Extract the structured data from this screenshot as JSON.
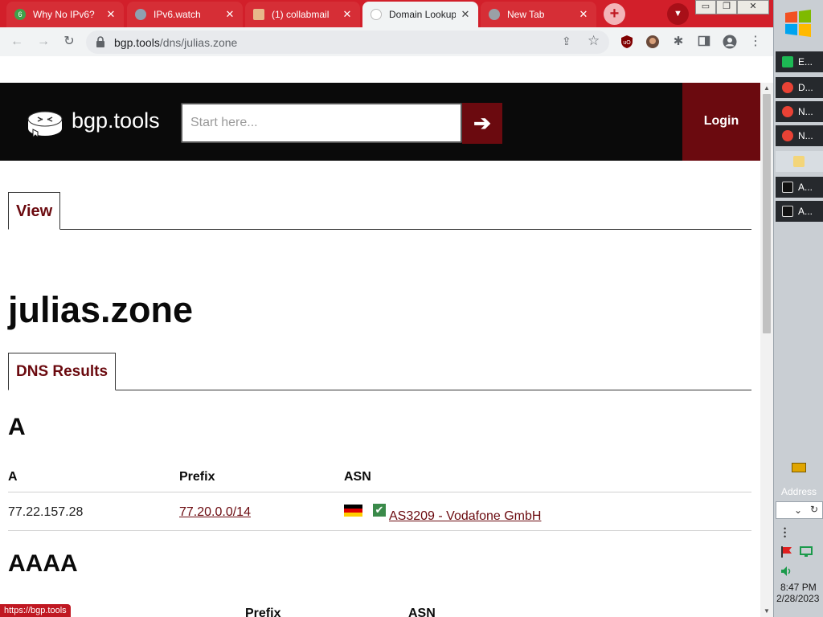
{
  "browser": {
    "tabs": [
      {
        "title": "Why No IPv6?",
        "state": "inactive"
      },
      {
        "title": "IPv6.watch",
        "state": "inactive"
      },
      {
        "title": "(1) collabmail",
        "state": "inactive"
      },
      {
        "title": "Domain Lookup",
        "state": "active"
      },
      {
        "title": "New Tab",
        "state": "inactive"
      }
    ],
    "new_tab_glyph": "+",
    "tab_close_glyph": "✕",
    "window_controls": {
      "minimize": "▭",
      "restore": "❐",
      "close": "✕"
    },
    "url_host": "bgp.tools",
    "url_path": "/dns/julias.zone",
    "omnibox_icons": {
      "share": "⇪",
      "star": "☆"
    },
    "extensions": [
      "ublock-origin-icon",
      "profile-photo-icon",
      "puzzle-extensions-icon",
      "side-panel-icon",
      "account-icon",
      "menu-dots-icon"
    ],
    "accent_color": "#d21f2a"
  },
  "site": {
    "name": "bgp.tools",
    "search_placeholder": "Start here...",
    "search_arrow": "➔",
    "login_label": "Login",
    "brand_color": "#6b0a0f"
  },
  "content": {
    "view_tab_label": "View",
    "domain": "julias.zone",
    "results_tab_label": "DNS Results",
    "a_section": {
      "heading": "A",
      "columns": [
        "A",
        "Prefix",
        "ASN"
      ],
      "rows": [
        {
          "address": "77.22.157.28",
          "prefix": "77.20.0.0/14",
          "asn_flag": "germany-flag-icon",
          "asn_check": "✔",
          "asn": "AS3209 - Vodafone GmbH"
        }
      ]
    },
    "aaaa_section": {
      "heading": "AAAA",
      "columns": [
        "Prefix",
        "ASN"
      ]
    }
  },
  "status_link": "https://bgp.tools",
  "taskbar": {
    "items": [
      {
        "label": "E...",
        "icon": "green-app-icon"
      },
      {
        "label": "D...",
        "icon": "chrome-icon"
      },
      {
        "label": "N...",
        "icon": "chrome-icon"
      },
      {
        "label": "N...",
        "icon": "chrome-icon"
      },
      {
        "label": "",
        "icon": "folder-icon"
      },
      {
        "label": "A...",
        "icon": "console-icon"
      },
      {
        "label": "A...",
        "icon": "console-icon"
      }
    ],
    "address_label": "Address",
    "clock_time": "8:47 PM",
    "clock_date": "2/28/2023"
  }
}
